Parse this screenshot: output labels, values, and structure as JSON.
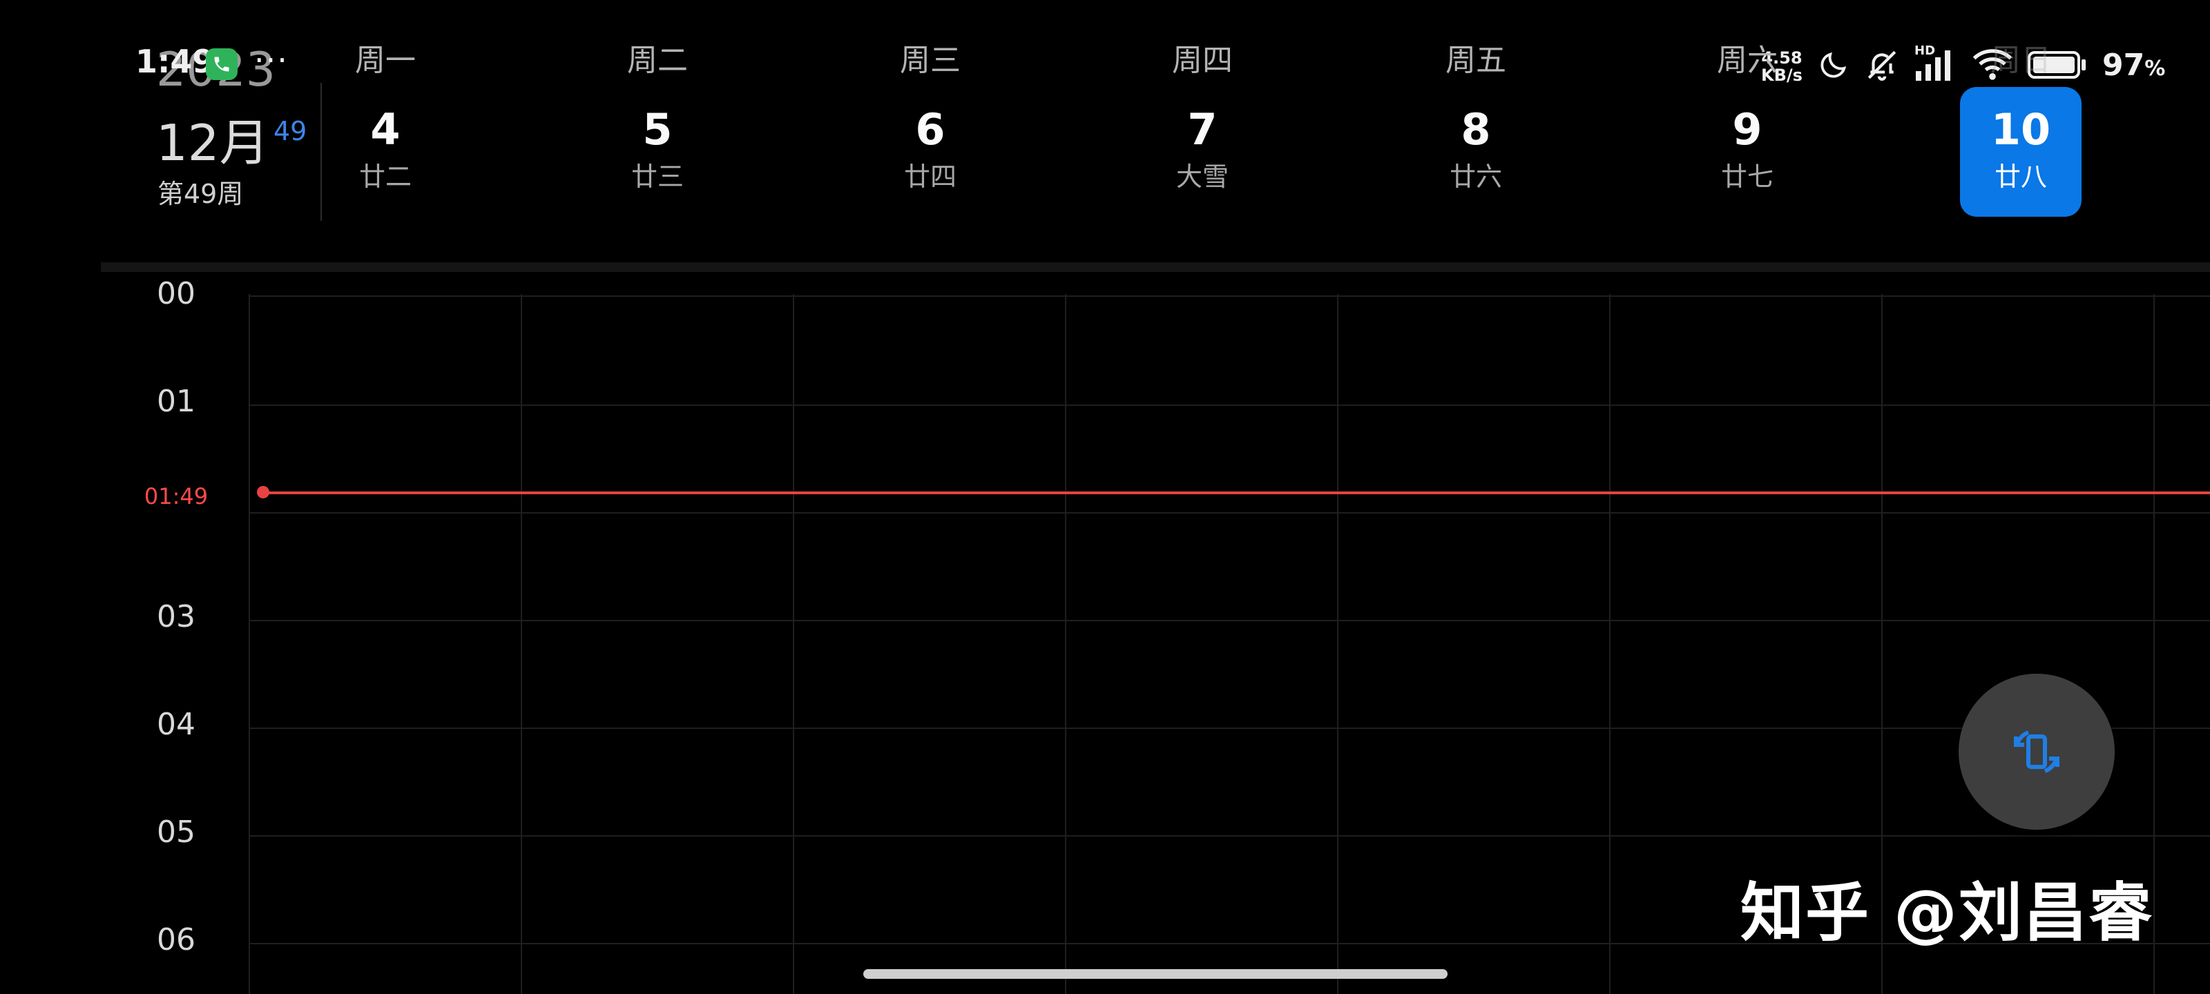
{
  "status_bar": {
    "time": "1:49",
    "dots": "···",
    "net_speed_value": "4.58",
    "net_speed_unit": "KB/s",
    "hd_label": "HD",
    "battery_percent": "97",
    "battery_unit": "%"
  },
  "header": {
    "year": "2023",
    "month": "12月",
    "week_number": "49",
    "week_label": "第49周"
  },
  "days": [
    {
      "weekday": "周一",
      "date": "4",
      "lunar": "廿二"
    },
    {
      "weekday": "周二",
      "date": "5",
      "lunar": "廿三"
    },
    {
      "weekday": "周三",
      "date": "6",
      "lunar": "廿四"
    },
    {
      "weekday": "周四",
      "date": "7",
      "lunar": "大雪"
    },
    {
      "weekday": "周五",
      "date": "8",
      "lunar": "廿六"
    },
    {
      "weekday": "周六",
      "date": "9",
      "lunar": "廿七"
    },
    {
      "weekday": "周日",
      "date": "10",
      "lunar": "廿八",
      "today": true
    }
  ],
  "hours": [
    "00",
    "01",
    "03",
    "04",
    "05",
    "06"
  ],
  "current_time_label": "01:49",
  "watermark": "知乎 @刘昌睿",
  "colors": {
    "background": "#000000",
    "accent_blue": "#0a78e6",
    "now_red": "#e84242",
    "call_green": "#2fb35a"
  },
  "icons": {
    "call": "phone-icon",
    "dnd": "moon-icon",
    "mute": "bell-off-icon",
    "signal": "signal-icon",
    "wifi": "wifi-icon",
    "battery": "battery-icon",
    "fab": "rotate-screen-icon"
  }
}
